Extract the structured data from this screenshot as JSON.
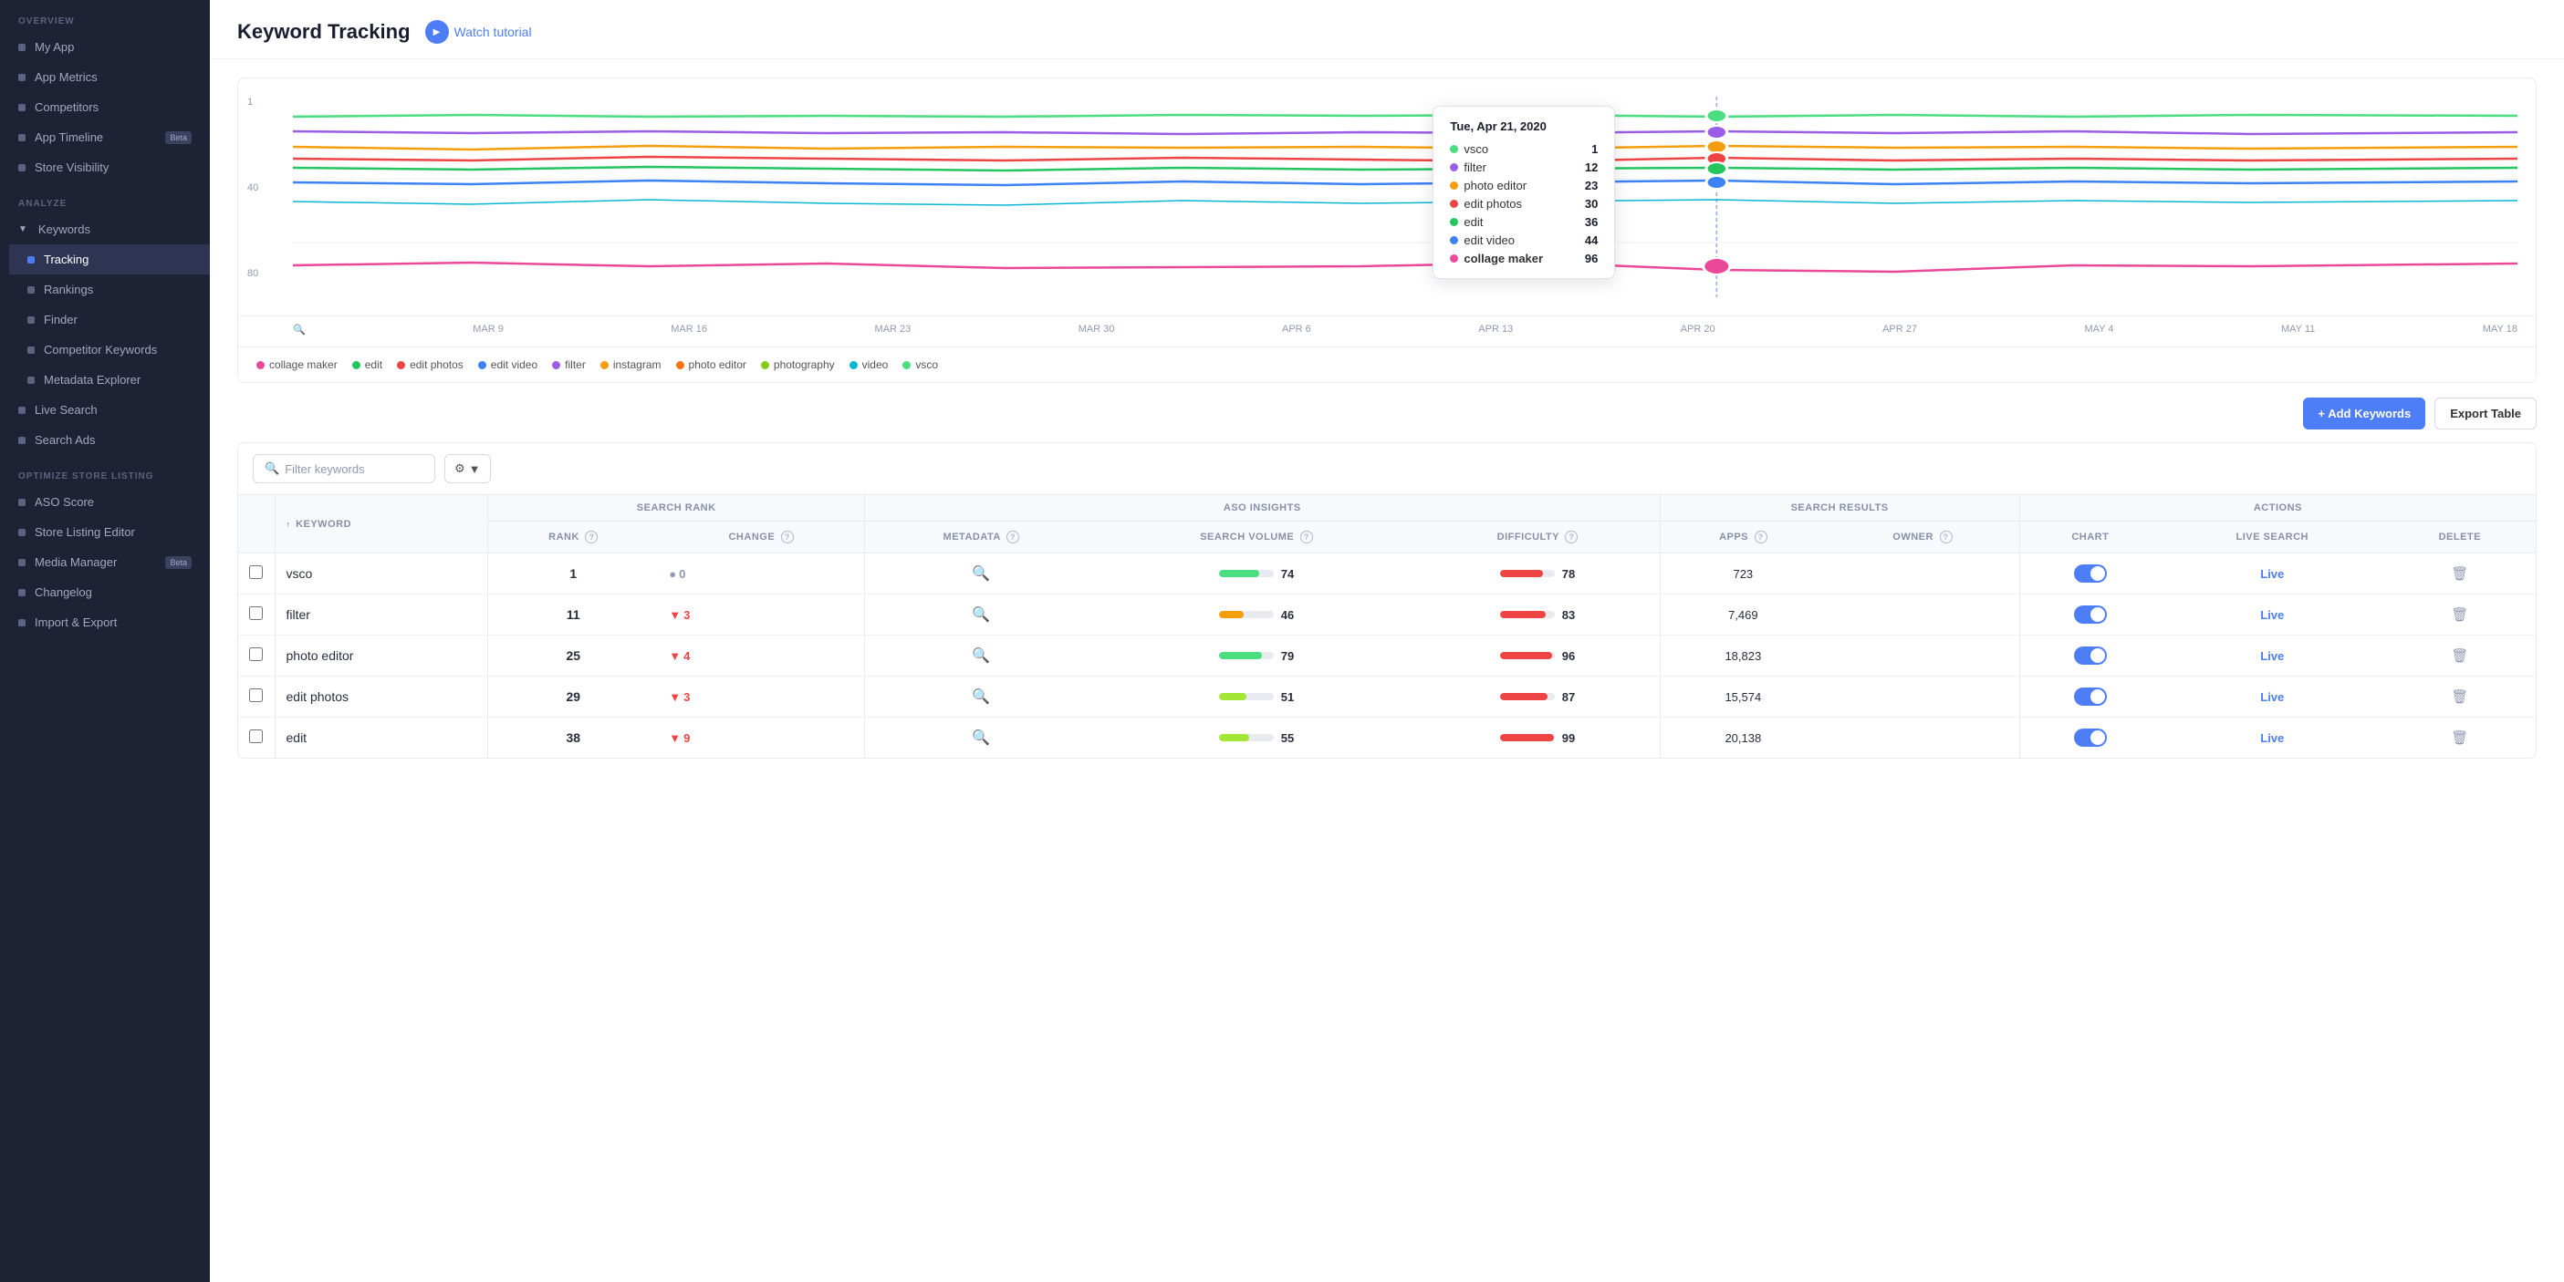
{
  "sidebar": {
    "overview_label": "OVERVIEW",
    "overview_items": [
      {
        "label": "My App",
        "active": false,
        "badge": null
      },
      {
        "label": "App Metrics",
        "active": false,
        "badge": null
      },
      {
        "label": "Competitors",
        "active": false,
        "badge": null
      },
      {
        "label": "App Timeline",
        "active": false,
        "badge": "Beta"
      },
      {
        "label": "Store Visibility",
        "active": false,
        "badge": null
      }
    ],
    "analyze_label": "ANALYZE",
    "keywords_label": "Keywords",
    "keywords_children": [
      {
        "label": "Tracking",
        "active": true
      },
      {
        "label": "Rankings",
        "active": false
      },
      {
        "label": "Finder",
        "active": false
      },
      {
        "label": "Competitor Keywords",
        "active": false
      },
      {
        "label": "Metadata Explorer",
        "active": false
      }
    ],
    "other_analyze": [
      {
        "label": "Live Search",
        "active": false
      },
      {
        "label": "Search Ads",
        "active": false
      }
    ],
    "optimize_label": "OPTIMIZE STORE LISTING",
    "optimize_items": [
      {
        "label": "ASO Score",
        "active": false,
        "badge": null
      },
      {
        "label": "Store Listing Editor",
        "active": false,
        "badge": null
      },
      {
        "label": "Media Manager",
        "active": false,
        "badge": "Beta"
      },
      {
        "label": "Changelog",
        "active": false,
        "badge": null
      },
      {
        "label": "Import & Export",
        "active": false,
        "badge": null
      }
    ]
  },
  "header": {
    "title": "Keyword Tracking",
    "tutorial_label": "Watch tutorial"
  },
  "chart": {
    "y_labels": [
      "1",
      "40",
      "80"
    ],
    "x_labels": [
      "MAR 9",
      "MAR 16",
      "MAR 23",
      "MAR 30",
      "APR 6",
      "APR 13",
      "APR 20",
      "APR 27",
      "MAY 4",
      "MAY 11",
      "MAY 18"
    ],
    "tooltip": {
      "date": "Tue, Apr 21, 2020",
      "rows": [
        {
          "label": "vsco",
          "value": "1",
          "color": "#4ade80",
          "bold": false
        },
        {
          "label": "filter",
          "value": "12",
          "color": "#9b5de5",
          "bold": false
        },
        {
          "label": "photo editor",
          "value": "23",
          "color": "#f59e0b",
          "bold": false
        },
        {
          "label": "edit photos",
          "value": "30",
          "color": "#ef4444",
          "bold": false
        },
        {
          "label": "edit",
          "value": "36",
          "color": "#22c55e",
          "bold": false
        },
        {
          "label": "edit video",
          "value": "44",
          "color": "#3b82f6",
          "bold": false
        },
        {
          "label": "collage maker",
          "value": "96",
          "color": "#ec4899",
          "bold": true
        }
      ]
    },
    "legend": [
      {
        "label": "collage maker",
        "color": "#ec4899"
      },
      {
        "label": "edit",
        "color": "#22c55e"
      },
      {
        "label": "edit photos",
        "color": "#ef4444"
      },
      {
        "label": "edit video",
        "color": "#3b82f6"
      },
      {
        "label": "filter",
        "color": "#9b5de5"
      },
      {
        "label": "instagram",
        "color": "#f59e0b"
      },
      {
        "label": "photo editor",
        "color": "#f97316"
      },
      {
        "label": "photography",
        "color": "#84cc16"
      },
      {
        "label": "video",
        "color": "#06b6d4"
      },
      {
        "label": "vsco",
        "color": "#4ade80"
      }
    ]
  },
  "table": {
    "add_keywords_label": "+ Add Keywords",
    "export_label": "Export Table",
    "filter_placeholder": "Filter keywords",
    "col_groups": [
      {
        "label": "SEARCH RANK",
        "colspan": 2
      },
      {
        "label": "ASO INSIGHTS",
        "colspan": 3
      },
      {
        "label": "SEARCH RESULTS",
        "colspan": 2
      },
      {
        "label": "ACTIONS",
        "colspan": 3
      }
    ],
    "columns": [
      {
        "label": "KEYWORD",
        "info": false,
        "sort": true
      },
      {
        "label": "RANK",
        "info": true,
        "sort": false
      },
      {
        "label": "CHANGE",
        "info": true,
        "sort": false
      },
      {
        "label": "METADATA",
        "info": true,
        "sort": false
      },
      {
        "label": "SEARCH VOLUME",
        "info": true,
        "sort": false
      },
      {
        "label": "DIFFICULTY",
        "info": true,
        "sort": false
      },
      {
        "label": "APPS",
        "info": true,
        "sort": false
      },
      {
        "label": "OWNER",
        "info": true,
        "sort": false
      },
      {
        "label": "CHART",
        "info": false,
        "sort": false
      },
      {
        "label": "LIVE SEARCH",
        "info": false,
        "sort": false
      },
      {
        "label": "DELETE",
        "info": false,
        "sort": false
      }
    ],
    "rows": [
      {
        "keyword": "vsco",
        "rank": "1",
        "change": "0",
        "change_type": "neutral",
        "search_volume": 74,
        "search_volume_color": "#4ade80",
        "difficulty": 78,
        "difficulty_color": "#ef4444",
        "apps": "723",
        "chart_on": true
      },
      {
        "keyword": "filter",
        "rank": "11",
        "change": "3",
        "change_type": "down",
        "search_volume": 46,
        "search_volume_color": "#f59e0b",
        "difficulty": 83,
        "difficulty_color": "#ef4444",
        "apps": "7,469",
        "chart_on": true
      },
      {
        "keyword": "photo editor",
        "rank": "25",
        "change": "4",
        "change_type": "down",
        "search_volume": 79,
        "search_volume_color": "#4ade80",
        "difficulty": 96,
        "difficulty_color": "#ef4444",
        "apps": "18,823",
        "chart_on": true
      },
      {
        "keyword": "edit photos",
        "rank": "29",
        "change": "3",
        "change_type": "down",
        "search_volume": 51,
        "search_volume_color": "#a3e635",
        "difficulty": 87,
        "difficulty_color": "#ef4444",
        "apps": "15,574",
        "chart_on": true
      },
      {
        "keyword": "edit",
        "rank": "38",
        "change": "9",
        "change_type": "down",
        "search_volume": 55,
        "search_volume_color": "#a3e635",
        "difficulty": 99,
        "difficulty_color": "#ef4444",
        "apps": "20,138",
        "chart_on": true
      }
    ]
  }
}
